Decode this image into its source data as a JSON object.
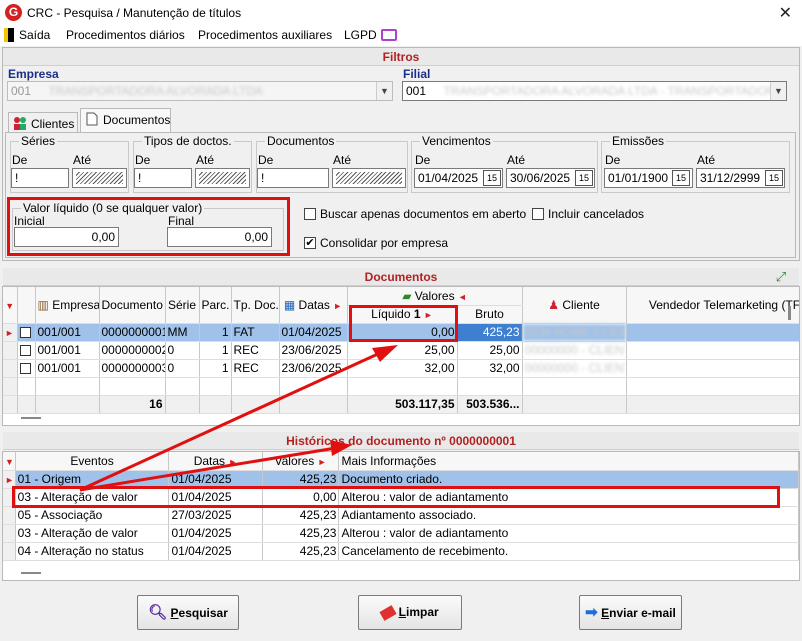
{
  "window": {
    "title": "CRC - Pesquisa / Manutenção de títulos",
    "close_glyph": "✕",
    "app_icon_letter": "G"
  },
  "menu": [
    "Saída",
    "Procedimentos diários",
    "Procedimentos auxiliares",
    "LGPD"
  ],
  "filters": {
    "header": "Filtros",
    "empresa": {
      "label": "Empresa",
      "code": "001",
      "name": "TRANSPORTADORA ALVORADA LTDA"
    },
    "filial": {
      "label": "Filial",
      "code": "001",
      "name": "TRANSPORTADORA ALVORADA LTDA - TRANSPORTADORA ALVORADA"
    },
    "tabs": [
      "Clientes",
      "Documentos"
    ],
    "series": {
      "title": "Séries",
      "de": "De",
      "ate": "Até",
      "de_value": "!"
    },
    "tipos": {
      "title": "Tipos de doctos.",
      "de": "De",
      "ate": "Até",
      "de_value": "!"
    },
    "documentos": {
      "title": "Documentos",
      "de": "De",
      "ate": "Até",
      "de_value": "!"
    },
    "vencimentos": {
      "title": "Vencimentos",
      "de": "De",
      "ate": "Até",
      "de_value": "01/04/2025",
      "ate_value": "30/06/2025"
    },
    "emissoes": {
      "title": "Emissões",
      "de": "De",
      "ate": "Até",
      "de_value": "01/01/1900",
      "ate_value": "31/12/2999"
    },
    "valor_liquido": {
      "title": "Valor líquido (0 se qualquer valor)",
      "inicial_label": "Inicial",
      "final_label": "Final",
      "inicial_value": "0,00",
      "final_value": "0,00"
    },
    "checks": {
      "em_aberto": {
        "label": "Buscar apenas documentos em aberto",
        "checked": false
      },
      "cancelados": {
        "label": "Incluir cancelados",
        "checked": false
      },
      "consolidar": {
        "label": "Consolidar por empresa",
        "checked": true,
        "mark": "✔"
      }
    },
    "calendar_glyph": "15"
  },
  "documents": {
    "header": "Documentos",
    "columns": {
      "empresa": "Empresa",
      "documento": "Documento",
      "serie": "Série",
      "parc": "Parc.",
      "tp_doc": "Tp. Doc.",
      "datas": "Datas",
      "valores": "Valores",
      "liquido": "Líquido",
      "liquido_idx": "1",
      "bruto": "Bruto",
      "cliente": "Cliente",
      "vendedor": "Vendedor Telemarketing (TF"
    },
    "rows": [
      {
        "empresa": "001/001",
        "documento": "0000000001",
        "serie": "MM",
        "parc": "1",
        "tp_doc": "FAT",
        "data": "01/04/2025",
        "liquido": "0,00",
        "bruto": "425,23",
        "cliente": "SEM NOME CLIENTE"
      },
      {
        "empresa": "001/001",
        "documento": "0000000002",
        "serie": "0",
        "parc": "1",
        "tp_doc": "REC",
        "data": "23/06/2025",
        "liquido": "25,00",
        "bruto": "25,00",
        "cliente": "00000000 - CLIENTE"
      },
      {
        "empresa": "001/001",
        "documento": "0000000003",
        "serie": "0",
        "parc": "1",
        "tp_doc": "REC",
        "data": "23/06/2025",
        "liquido": "32,00",
        "bruto": "32,00",
        "cliente": "00000000 - CLIENTE"
      }
    ],
    "totals": {
      "count": "16",
      "liquido": "503.117,35",
      "bruto": "503.536..."
    }
  },
  "history": {
    "header": "Históricos do documento nº 0000000001",
    "columns": {
      "eventos": "Eventos",
      "datas": "Datas",
      "valores": "Valores",
      "info": "Mais Informações"
    },
    "rows": [
      {
        "evento": "01 - Origem",
        "data": "01/04/2025",
        "valor": "425,23",
        "info": "Documento criado."
      },
      {
        "evento": "03 - Alteração de valor",
        "data": "01/04/2025",
        "valor": "0,00",
        "info": "Alterou : valor de adiantamento"
      },
      {
        "evento": "05 - Associação",
        "data": "27/03/2025",
        "valor": "425,23",
        "info": "Adiantamento associado."
      },
      {
        "evento": "03 - Alteração de valor",
        "data": "01/04/2025",
        "valor": "425,23",
        "info": "Alterou : valor de adiantamento"
      },
      {
        "evento": "04 - Alteração no status",
        "data": "01/04/2025",
        "valor": "425,23",
        "info": "Cancelamento de recebimento."
      }
    ]
  },
  "buttons": {
    "pesquisar": {
      "underline": "P",
      "rest": "esquisar"
    },
    "limpar": {
      "underline": "L",
      "rest": "impar"
    },
    "enviar": {
      "underline": "E",
      "rest": "nviar e-mail"
    }
  },
  "colors": {
    "accent_red": "#b22222",
    "selection": "#9fc1ea",
    "annotation": "#e01010"
  }
}
